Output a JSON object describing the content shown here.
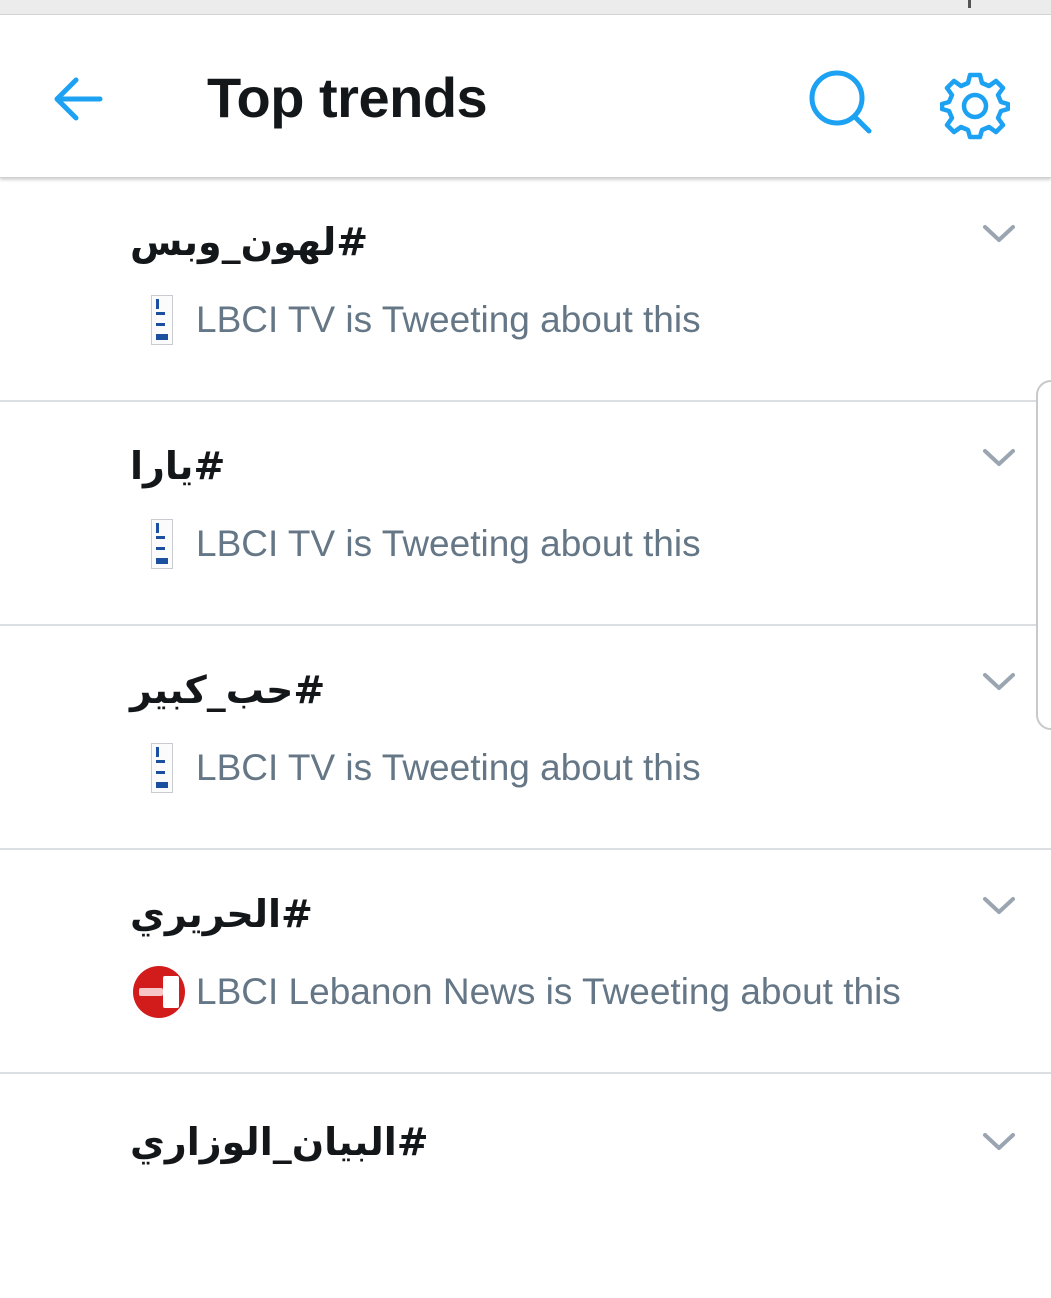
{
  "header": {
    "title": "Top trends",
    "back_icon": "arrow-left-icon",
    "search_icon": "search-icon",
    "settings_icon": "gear-icon",
    "accent_color": "#1da1f2"
  },
  "trends": [
    {
      "name": "#لهون_وبس",
      "context": "LBCI TV is Tweeting about this",
      "source_icon": "lbci-tv-logo"
    },
    {
      "name": "#يارا",
      "context": "LBCI TV is Tweeting about this",
      "source_icon": "lbci-tv-logo"
    },
    {
      "name": "#حب_كبير",
      "context": "LBCI TV is Tweeting about this",
      "source_icon": "lbci-tv-logo"
    },
    {
      "name": "#الحريري",
      "context": "LBCI Lebanon News is Tweeting about this",
      "source_icon": "lbci-news-logo"
    },
    {
      "name": "#البيان_الوزاري",
      "context": "",
      "source_icon": ""
    }
  ]
}
